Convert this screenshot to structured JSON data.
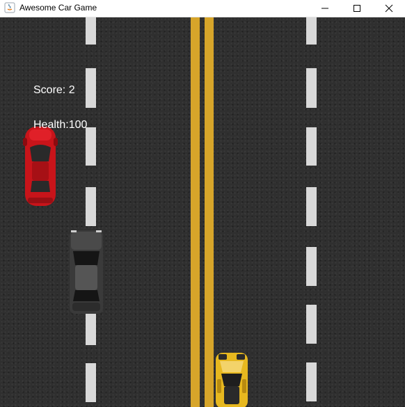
{
  "window": {
    "title": "Awesome Car Game",
    "controls": [
      "minimize",
      "maximize",
      "close"
    ]
  },
  "hud": {
    "score_label": "Score:",
    "score": 2,
    "health_label": "Health:",
    "health": 100
  },
  "game": {
    "road_color": "#2f2f2f",
    "lane_marking_color": "#d9d9d9",
    "center_line_color": "#d7a52a",
    "cars": [
      {
        "name": "red-car",
        "color": "#c8141a"
      },
      {
        "name": "black-car",
        "color": "#3a3a3a"
      },
      {
        "name": "yellow-player-car",
        "color": "#e7b81f"
      }
    ]
  }
}
